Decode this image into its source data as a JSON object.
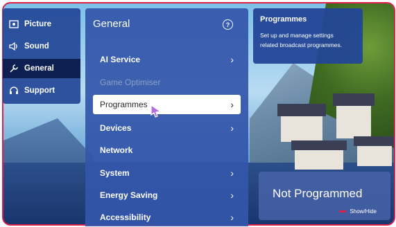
{
  "left_menu": {
    "items": [
      {
        "label": "Picture",
        "icon": "picture-icon"
      },
      {
        "label": "Sound",
        "icon": "speaker-icon"
      },
      {
        "label": "General",
        "icon": "wrench-icon",
        "active": true
      },
      {
        "label": "Support",
        "icon": "headset-icon"
      }
    ]
  },
  "general": {
    "title": "General",
    "help": "?",
    "items": [
      {
        "label": "AI Service",
        "state": "normal"
      },
      {
        "label": "Game Optimiser",
        "state": "disabled"
      },
      {
        "label": "Programmes",
        "state": "focused"
      },
      {
        "label": "Devices",
        "state": "normal"
      },
      {
        "label": "Network",
        "state": "normal"
      },
      {
        "label": "System",
        "state": "normal"
      },
      {
        "label": "Energy Saving",
        "state": "normal"
      },
      {
        "label": "Accessibility",
        "state": "normal"
      }
    ],
    "chevron": "›"
  },
  "info_panel": {
    "title": "Programmes",
    "description_line1": "Set up and manage settings",
    "description_line2": "related broadcast programmes."
  },
  "channel_box": {
    "status": "Not Programmed",
    "show_hide": "Show/Hide"
  },
  "colors": {
    "accent": "#e0204a",
    "panel": "#3456aa",
    "active_item": "#0e1f52"
  }
}
